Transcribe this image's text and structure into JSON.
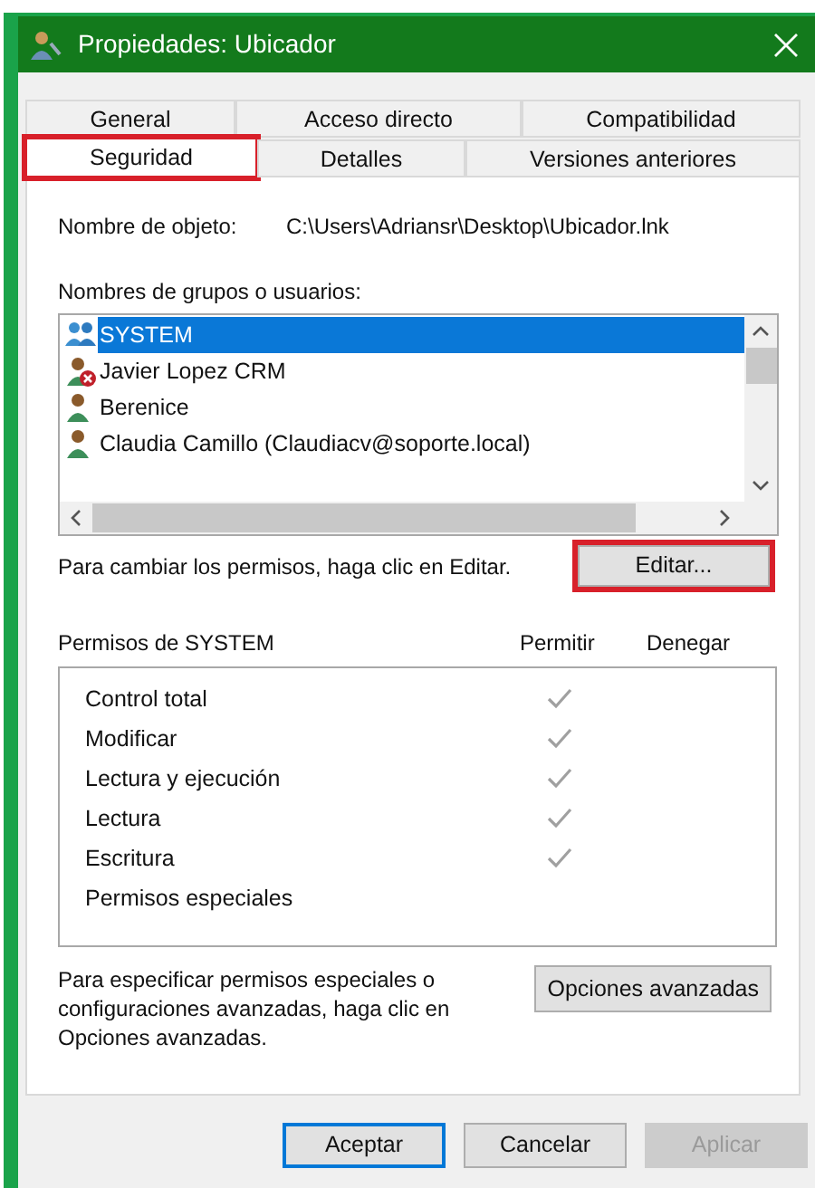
{
  "window": {
    "title": "Propiedades: Ubicador"
  },
  "tab_rows": [
    [
      {
        "label": "General",
        "selected": false,
        "highlighted": false
      },
      {
        "label": "Acceso directo",
        "selected": false,
        "highlighted": false
      },
      {
        "label": "Compatibilidad",
        "selected": false,
        "highlighted": false
      }
    ],
    [
      {
        "label": "Seguridad",
        "selected": true,
        "highlighted": true
      },
      {
        "label": "Detalles",
        "selected": false,
        "highlighted": false
      },
      {
        "label": "Versiones anteriores",
        "selected": false,
        "highlighted": false
      }
    ]
  ],
  "object_name": {
    "label": "Nombre de objeto:",
    "value": "C:\\Users\\Adriansr\\Desktop\\Ubicador.lnk"
  },
  "users": {
    "label": "Nombres de grupos o usuarios:",
    "items": [
      {
        "name": "SYSTEM",
        "kind": "group",
        "selected": true
      },
      {
        "name": "Javier Lopez CRM",
        "kind": "unknown_user",
        "selected": false
      },
      {
        "name": "Berenice",
        "kind": "user",
        "selected": false
      },
      {
        "name": "Claudia Camillo (Claudiacv@soporte.local)",
        "kind": "user",
        "selected": false
      }
    ]
  },
  "edit_hint": "Para cambiar los permisos, haga clic en Editar.",
  "edit_button": {
    "label": "Editar...",
    "highlighted": true
  },
  "permissions": {
    "title": "Permisos de SYSTEM",
    "columns": [
      "Permitir",
      "Denegar"
    ],
    "items": [
      {
        "name": "Control total",
        "allow": true
      },
      {
        "name": "Modificar",
        "allow": true
      },
      {
        "name": "Lectura y ejecución",
        "allow": true
      },
      {
        "name": "Lectura",
        "allow": true
      },
      {
        "name": "Escritura",
        "allow": true
      },
      {
        "name": "Permisos especiales",
        "allow": false
      }
    ]
  },
  "advanced": {
    "text": "Para especificar permisos especiales o configuraciones avanzadas, haga clic en Opciones avanzadas.",
    "button": "Opciones avanzadas"
  },
  "buttons": [
    {
      "label": "Aceptar",
      "default": true,
      "disabled": false
    },
    {
      "label": "Cancelar",
      "default": false,
      "disabled": false
    },
    {
      "label": "Aplicar",
      "default": false,
      "disabled": true
    }
  ]
}
